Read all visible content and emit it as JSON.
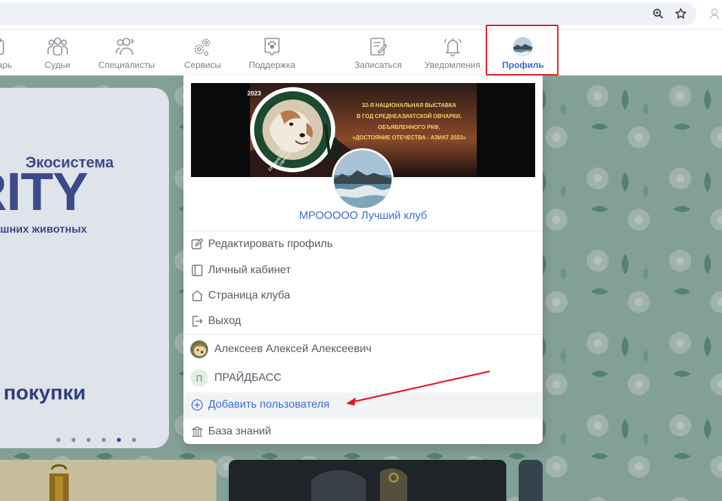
{
  "nav": {
    "items": [
      {
        "label": "дарь"
      },
      {
        "label": "Судьи"
      },
      {
        "label": "Специалисты"
      },
      {
        "label": "Сервисы"
      },
      {
        "label": "Поддержка"
      },
      {
        "label": "Записаться"
      },
      {
        "label": "Уведомления"
      },
      {
        "label": "Профиль"
      }
    ]
  },
  "banner": {
    "brand": "Экосистема",
    "big": "RITY",
    "sub": "домашних животных",
    "promo": "ой покупки"
  },
  "profile_menu": {
    "cover": {
      "badge_year": "2023",
      "badge_ring": "ГОД СРЕДНЕАЗИАТСКОЙ ОВЧАРКИ",
      "lines": [
        "32-Я НАЦИОНАЛЬНАЯ ВЫСТАВКА",
        "В ГОД СРЕДНЕАЗИАТСКОЙ ОВЧАРКИ,",
        "ОБЪЯВЛЕННОГО РКФ,",
        "«ДОСТОЯНИЕ ОТЕЧЕСТВА - АЗИАТ 2023»"
      ]
    },
    "club_name": "МРООООО Лучший клуб",
    "edit_profile": "Редактировать профиль",
    "personal_cabinet": "Личный кабинет",
    "club_page": "Страница клуба",
    "logout": "Выход",
    "users": [
      {
        "name": "Алексеев Алексей Алексеевич"
      },
      {
        "name": "ПРАЙДБАСС",
        "initial": "П"
      }
    ],
    "add_user": "Добавить пользователя",
    "knowledge_base": "База знаний"
  },
  "colors": {
    "accent": "#3b6bd8",
    "annotation_red": "#e4161c"
  }
}
